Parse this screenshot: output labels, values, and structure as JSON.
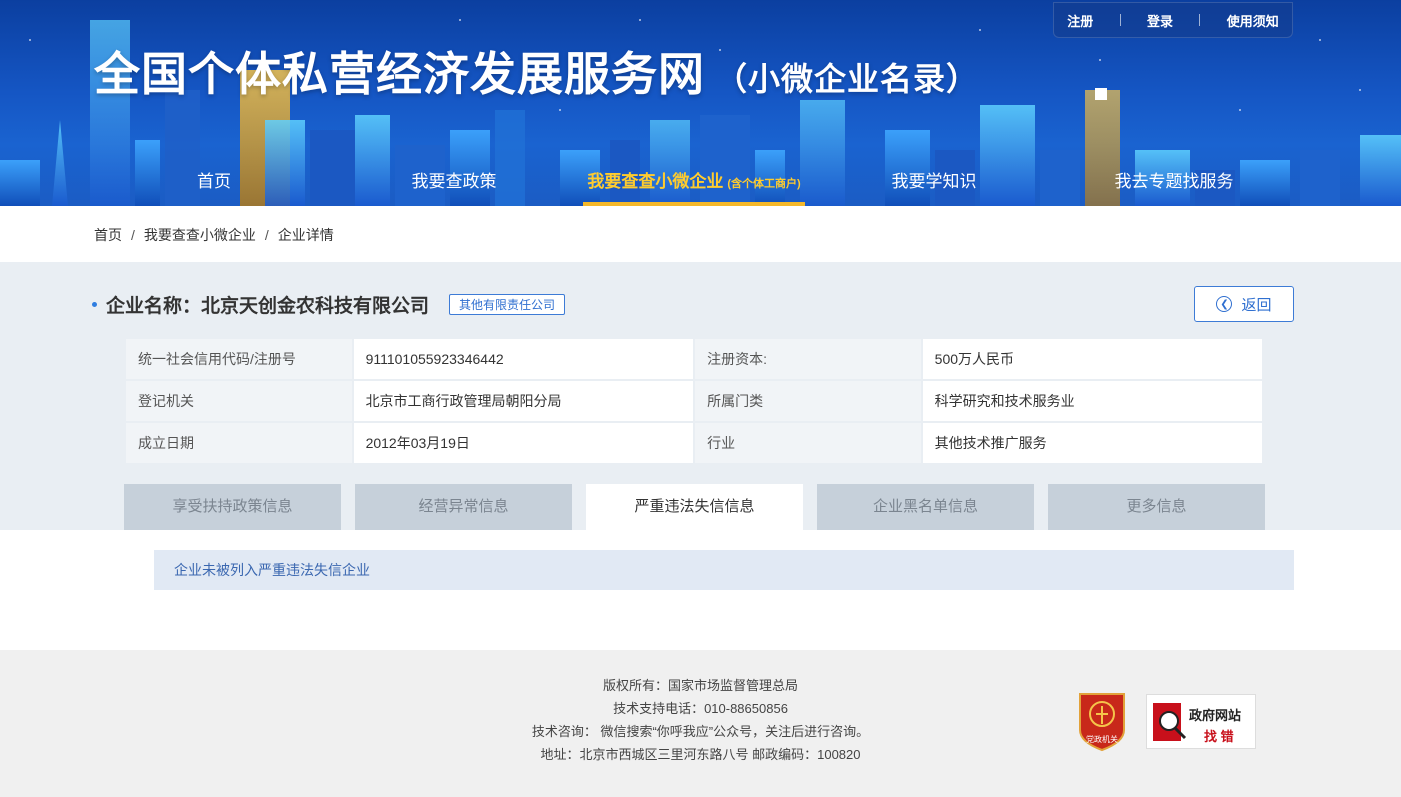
{
  "header": {
    "title": "全国个体私营经济发展服务网",
    "subtitle": "（小微企业名录）",
    "top_links": [
      "注册",
      "登录",
      "使用须知"
    ]
  },
  "nav": {
    "items": [
      {
        "label": "首页"
      },
      {
        "label": "我要查政策"
      },
      {
        "label": "我要查查小微企业",
        "small": "(含个体工商户)"
      },
      {
        "label": "我要学知识"
      },
      {
        "label": "我去专题找服务"
      }
    ],
    "active_index": 2
  },
  "breadcrumb": {
    "items": [
      "首页",
      "我要查查小微企业",
      "企业详情"
    ],
    "separator": "/"
  },
  "company": {
    "label": "企业名称：",
    "name": "北京天创金农科技有限公司",
    "type_tag": "其他有限责任公司",
    "back_label": "返回"
  },
  "info_table": {
    "rows": [
      [
        "统一社会信用代码/注册号",
        "91110105592334644​2",
        "注册资本:",
        "500万人民币"
      ],
      [
        "登记机关",
        "北京市工商行政管理局朝阳分局",
        "所属门类",
        "科学研究和技术服务业"
      ],
      [
        "成立日期",
        "2012年03月19日",
        "行业",
        "其他技术推广服务"
      ]
    ]
  },
  "tabs": {
    "items": [
      "享受扶持政策信息",
      "经营异常信息",
      "严重违法失信信息",
      "企业黑名单信息",
      "更多信息"
    ],
    "active_index": 2
  },
  "notice": {
    "text": "企业未被列入严重违法失信企业"
  },
  "footer": {
    "lines": [
      "版权所有：国家市场监督管理总局",
      "技术支持电话：010-88650856",
      "技术咨询： 微信搜索“你呼我应”公众号，关注后进行咨询。",
      "地址：北京市西城区三里河东路八号 邮政编码：100820"
    ],
    "party_badge": "党政机关",
    "gov_badge_line1": "政府网站",
    "gov_badge_line2": "找 错"
  },
  "colors": {
    "header_blue": "#1556c4",
    "nav_active": "#ffcc2e",
    "accent_blue": "#2f6fd0",
    "tab_inactive": "#c6d0da",
    "grey_bg": "#e9eef3"
  }
}
